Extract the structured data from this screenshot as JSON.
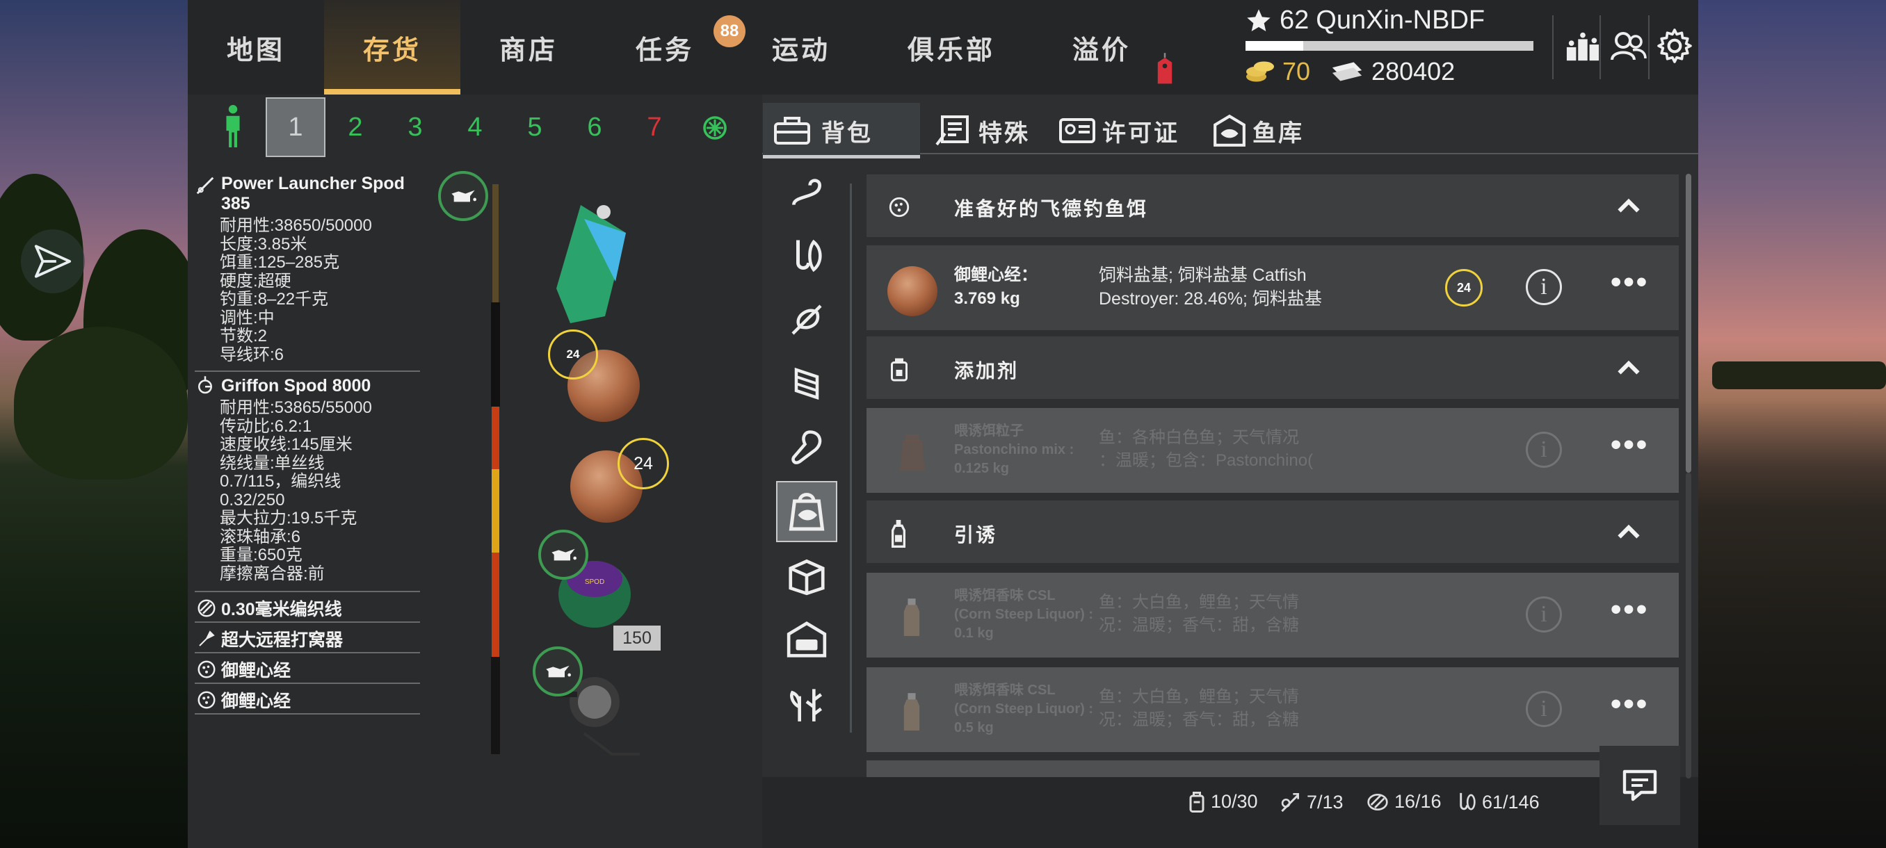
{
  "nav": {
    "tabs": [
      "地图",
      "存货",
      "商店",
      "任务",
      "运动",
      "俱乐部",
      "溢价"
    ],
    "active": 1,
    "task_badge": "88"
  },
  "profile": {
    "level": "62",
    "name": "QunXin-NBDF",
    "xp_fraction": 0.2,
    "gold": "70",
    "credits": "280402"
  },
  "slots": {
    "labels": [
      "1",
      "2",
      "3",
      "4",
      "5",
      "6",
      "7"
    ],
    "selected": 0,
    "colors": [
      "#cfd2d2",
      "#36c15a",
      "#36c15a",
      "#36c15a",
      "#36c15a",
      "#36c15a",
      "#d9333a"
    ]
  },
  "rod": {
    "name_line1": "Power Launcher Spod",
    "name_line2": "385",
    "specs": [
      "耐用性:38650/50000",
      "长度:3.85米",
      "饵重:125–285克",
      "硬度:超硬",
      "钓重:8–22千克",
      "调性:中",
      "节数:2",
      "导线环:6"
    ]
  },
  "reel": {
    "name": "Griffon Spod 8000",
    "specs": [
      "耐用性:53865/55000",
      "传动比:6.2:1",
      "速度收线:145厘米",
      "绕线量:单丝线",
      "0.7/115，编织线",
      "0.32/250",
      "最大拉力:19.5千克",
      "滚珠轴承:6",
      "重量:650克",
      "摩擦离合器:前"
    ]
  },
  "equip": [
    "0.30毫米编织线",
    "超大远程打窝器",
    "御鲤心经",
    "御鲤心经"
  ],
  "rig": {
    "bait_count_1": "24",
    "bait_count_2": "24",
    "line_length": "150"
  },
  "inv_tabs": [
    "背包",
    "特殊",
    "许可证",
    "鱼库"
  ],
  "sections": [
    {
      "title": "准备好的飞德钓鱼饵",
      "items": [
        {
          "name1": "御鲤心经：",
          "name2": "3.769 kg",
          "desc1": "饲料盐基; 饲料盐基 Catfish",
          "desc2": "Destroyer: 28.46%; 饲料盐基",
          "count": "24",
          "dim": false
        }
      ]
    },
    {
      "title": "添加剂",
      "items": [
        {
          "name1": "喂诱饵粒子",
          "name2": "Pastonchino mix :",
          "name3": "0.125 kg",
          "desc1": "鱼：各种白色鱼；天气情况",
          "desc2": "：温暖；包含：Pastonchino(",
          "dim": true
        }
      ]
    },
    {
      "title": "引诱",
      "items": [
        {
          "name1": "喂诱饵香味 CSL",
          "name2": "(Corn Steep Liquor) :",
          "name3": "0.1 kg",
          "desc1": "鱼：大白鱼，鲤鱼；天气情",
          "desc2": "况：温暖；香气：甜，含糖",
          "dim": true
        },
        {
          "name1": "喂诱饵香味 CSL",
          "name2": "(Corn Steep Liquor) :",
          "name3": "0.5 kg",
          "desc1": "鱼：大白鱼，鲤鱼；天气情",
          "desc2": "况：温暖；香气：甜，含糖",
          "dim": true
        }
      ]
    }
  ],
  "status": {
    "bags": "10/30",
    "rods": "7/13",
    "lines": "16/16",
    "tackle": "61/146"
  },
  "icons": [
    "star-icon",
    "coin-icon",
    "banknote-icon",
    "leaderboard-icon",
    "friends-icon",
    "gear-icon",
    "angler-icon",
    "bait-icon",
    "info-icon",
    "more-icon",
    "chat-icon",
    "send-icon",
    "oil-icon"
  ]
}
